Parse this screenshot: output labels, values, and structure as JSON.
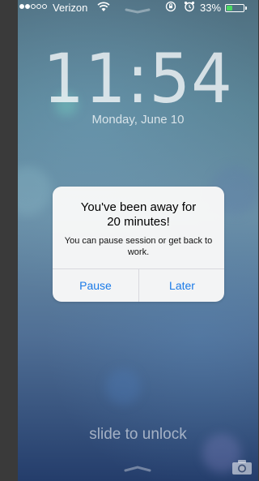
{
  "status_bar": {
    "carrier": "Verizon",
    "battery_text": "33%",
    "battery_level": 0.33,
    "battery_color": "#4cd964",
    "signal_bars_filled": 2,
    "signal_bars_total": 5,
    "icons": [
      "wifi-icon",
      "rotation-lock-icon",
      "alarm-icon",
      "battery-icon"
    ]
  },
  "lock_screen": {
    "time": "11:54",
    "date": "Monday, June 10",
    "slide_text": "slide to unlock"
  },
  "alert": {
    "title_line1": "You've been away for",
    "title_line2": "20 minutes!",
    "message": "You can pause session or get back to work.",
    "buttons": {
      "pause": "Pause",
      "later": "Later"
    },
    "button_color": "#1a7ae8"
  }
}
